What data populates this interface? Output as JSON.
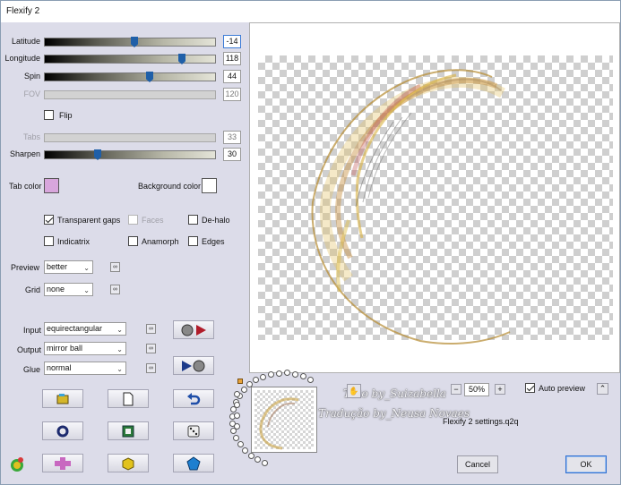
{
  "window": {
    "title": "Flexify 2"
  },
  "sliders": [
    {
      "label": "Latitude",
      "value": "-14",
      "fraction": 0.53,
      "disabled": false,
      "selected": true
    },
    {
      "label": "Longitude",
      "value": "118",
      "fraction": 0.82,
      "disabled": false,
      "selected": false
    },
    {
      "label": "Spin",
      "value": "44",
      "fraction": 0.62,
      "disabled": false,
      "selected": false
    },
    {
      "label": "FOV",
      "value": "120",
      "fraction": 0,
      "disabled": true,
      "selected": false
    },
    {
      "label": "Tabs",
      "value": "33",
      "fraction": 0,
      "disabled": true,
      "selected": false
    },
    {
      "label": "Sharpen",
      "value": "30",
      "fraction": 0.3,
      "disabled": false,
      "selected": false
    }
  ],
  "flip": {
    "label": "Flip",
    "checked": false
  },
  "colors": {
    "tab_label": "Tab color",
    "tab_value": "#d8a6dc",
    "bg_label": "Background color",
    "bg_value": "#ffffff"
  },
  "options": {
    "transparent_gaps": "Transparent gaps",
    "faces": "Faces",
    "dehalo": "De-halo",
    "indicatrix": "Indicatrix",
    "anamorph": "Anamorph",
    "edges": "Edges"
  },
  "preview_quality": {
    "label": "Preview",
    "value": "better"
  },
  "grid": {
    "label": "Grid",
    "value": "none"
  },
  "input": {
    "label": "Input",
    "value": "equirectangular"
  },
  "output": {
    "label": "Output",
    "value": "mirror ball"
  },
  "glue": {
    "label": "Glue",
    "value": "normal"
  },
  "zoom": {
    "value": "50%",
    "minus": "−",
    "plus": "+"
  },
  "auto_preview": {
    "label": "Auto preview",
    "checked": true
  },
  "settings_file": "Flexify 2 settings.q2q",
  "watermark": {
    "line1": "Tuto by_Suizabella",
    "line2": "Tradução by_Neusa Novaes"
  },
  "buttons": {
    "cancel": "Cancel",
    "ok": "OK"
  },
  "accent": "#2f6fd0"
}
